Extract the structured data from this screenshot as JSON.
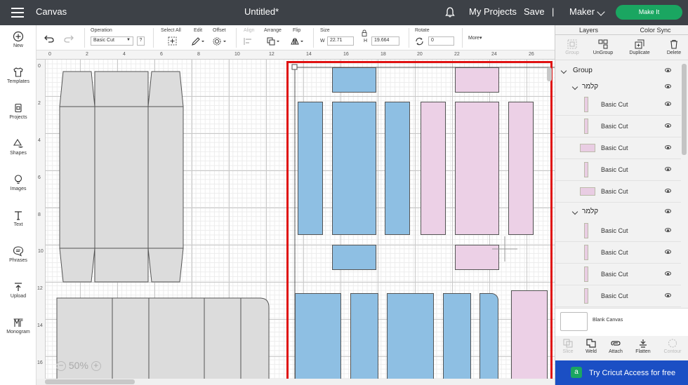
{
  "header": {
    "menu_icon": "hamburger-icon",
    "app_title": "Canvas",
    "doc_title": "Untitled*",
    "bell_icon": "bell-icon",
    "my_projects": "My Projects",
    "save": "Save",
    "separator": "|",
    "machine": "Maker",
    "make_it": "Make It"
  },
  "sidebar": {
    "items": [
      {
        "label": "New",
        "icon": "plus-circle-icon"
      },
      {
        "label": "Templates",
        "icon": "shirt-icon"
      },
      {
        "label": "Projects",
        "icon": "projects-icon"
      },
      {
        "label": "Shapes",
        "icon": "shapes-icon"
      },
      {
        "label": "Images",
        "icon": "lightbulb-icon"
      },
      {
        "label": "Text",
        "icon": "text-icon"
      },
      {
        "label": "Phrases",
        "icon": "speech-bubble-icon"
      },
      {
        "label": "Upload",
        "icon": "upload-icon"
      },
      {
        "label": "Monogram",
        "icon": "monogram-icon"
      }
    ]
  },
  "toolbar": {
    "operation_label": "Operation",
    "operation_value": "Basic Cut",
    "help": "?",
    "select_all": "Select All",
    "edit": "Edit",
    "offset": "Offset",
    "align": "Align",
    "arrange": "Arrange",
    "flip": "Flip",
    "size": "Size",
    "w_label": "W",
    "w_value": "22.71",
    "h_label": "H",
    "h_value": "19.664",
    "rotate": "Rotate",
    "rotate_value": "0",
    "more": "More▾"
  },
  "ruler": {
    "top": [
      "0",
      "2",
      "4",
      "6",
      "8",
      "10",
      "12",
      "14",
      "16",
      "18",
      "20",
      "22",
      "24",
      "26"
    ],
    "left": [
      "0",
      "2",
      "4",
      "6",
      "8",
      "10",
      "12",
      "14",
      "16"
    ]
  },
  "canvas": {
    "zoom": "50%",
    "zoom_out": "−",
    "zoom_in": "+"
  },
  "panel": {
    "tabs": [
      "Layers",
      "Color Sync"
    ],
    "actions": [
      {
        "label": "Group",
        "icon": "group-icon",
        "enabled": false
      },
      {
        "label": "UnGroup",
        "icon": "ungroup-icon",
        "enabled": true
      },
      {
        "label": "Duplicate",
        "icon": "duplicate-icon",
        "enabled": true
      },
      {
        "label": "Delete",
        "icon": "trash-icon",
        "enabled": true
      }
    ],
    "group_label": "Group",
    "subgroups": [
      {
        "label": "קלמר",
        "layers": [
          "Basic Cut",
          "Basic Cut",
          "Basic Cut",
          "Basic Cut",
          "Basic Cut"
        ]
      },
      {
        "label": "קלמר",
        "layers": [
          "Basic Cut",
          "Basic Cut",
          "Basic Cut",
          "Basic Cut"
        ]
      }
    ],
    "blank_canvas": "Blank Canvas",
    "bottom_actions": [
      {
        "label": "Slice",
        "icon": "slice-icon",
        "enabled": false
      },
      {
        "label": "Weld",
        "icon": "weld-icon",
        "enabled": true
      },
      {
        "label": "Attach",
        "icon": "attach-icon",
        "enabled": true
      },
      {
        "label": "Flatten",
        "icon": "flatten-icon",
        "enabled": true
      },
      {
        "label": "Contour",
        "icon": "contour-icon",
        "enabled": false
      }
    ],
    "cta": "Try Cricut Access for free",
    "cta_logo": "a"
  },
  "colors": {
    "topbar": "#3d4147",
    "make_it": "#1aa661",
    "blue_shape": "#8ebfe3",
    "pink_shape": "#ecd0e6",
    "selection": "#e01212",
    "cta": "#1b4fc4"
  }
}
